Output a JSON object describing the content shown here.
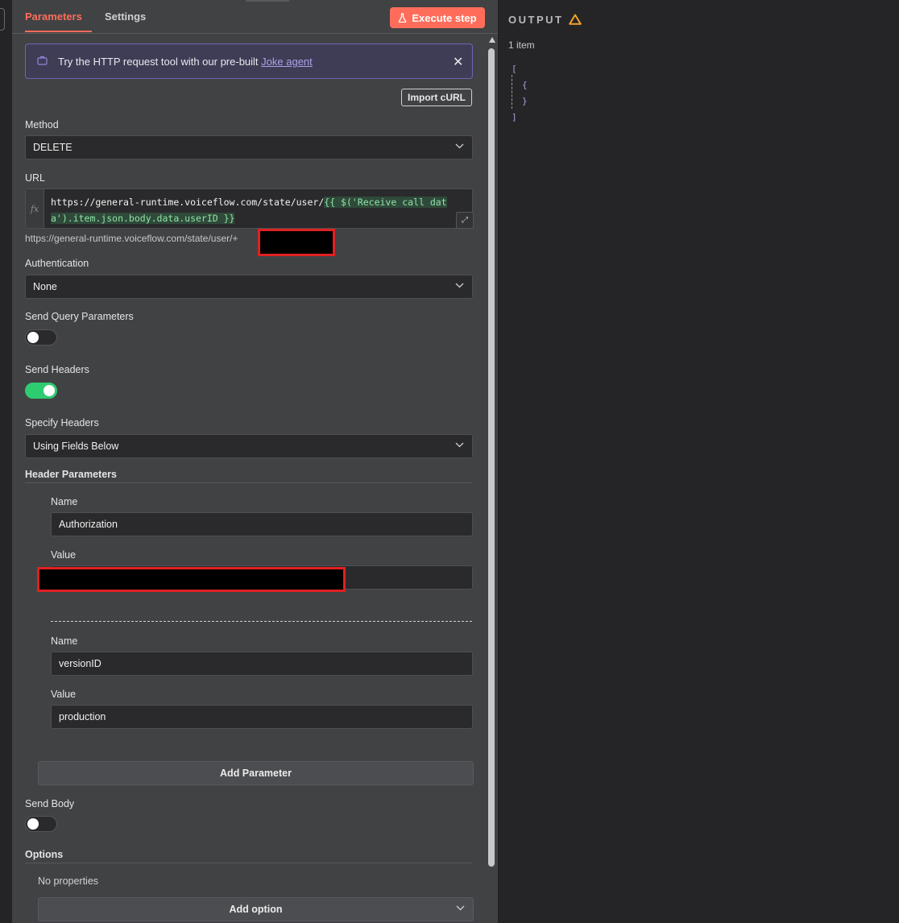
{
  "tabs": [
    {
      "label": "Parameters"
    },
    {
      "label": "Settings"
    }
  ],
  "execute_button": {
    "label": "Execute step"
  },
  "banner": {
    "text": "Try the HTTP request tool with our pre-built ",
    "link": "Joke agent",
    "close": "✕"
  },
  "import_curl": {
    "label": "Import cURL"
  },
  "method": {
    "label": "Method",
    "value": "DELETE"
  },
  "url": {
    "label": "URL",
    "fx": "fx",
    "static_part": "https://general-runtime.voiceflow.com/state/user/",
    "expression": "{{ $('Receive call data').item.json.body.data.userID }}",
    "preview": "https://general-runtime.voiceflow.com/state/user/+"
  },
  "authentication": {
    "label": "Authentication",
    "value": "None"
  },
  "send_query": {
    "label": "Send Query Parameters",
    "enabled": false
  },
  "send_headers": {
    "label": "Send Headers",
    "enabled": true
  },
  "specify_headers": {
    "label": "Specify Headers",
    "value": "Using Fields Below"
  },
  "header_parameters": {
    "label": "Header Parameters",
    "items": [
      {
        "name_label": "Name",
        "name": "Authorization",
        "value_label": "Value",
        "value": ""
      },
      {
        "name_label": "Name",
        "name": "versionID",
        "value_label": "Value",
        "value": "production"
      }
    ],
    "add_label": "Add Parameter"
  },
  "send_body": {
    "label": "Send Body",
    "enabled": false
  },
  "options": {
    "label": "Options",
    "empty_text": "No properties",
    "add_label": "Add option"
  },
  "output": {
    "title": "OUTPUT",
    "count": "1 item",
    "json_lines": [
      "[",
      "{",
      "}",
      "]"
    ],
    "colors": {
      "warning": "#f0a12b",
      "json": "#a6a2e0"
    }
  },
  "colors": {
    "accent": "#ff6d5a",
    "toggle_on": "#2ecc71",
    "panel": "#414244",
    "link": "#a9a2e8"
  }
}
